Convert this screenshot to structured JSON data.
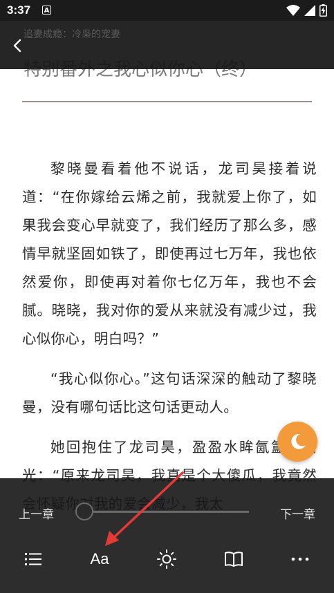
{
  "status_bar": {
    "time": "3:37",
    "notification_letter": "A",
    "icons": [
      "wifi-icon",
      "signal-icon",
      "battery-charging-icon"
    ]
  },
  "top_bar": {
    "book_name": "追妻成瘾：冷枭的宠妻",
    "back_icon": "chevron-left-icon"
  },
  "chapter": {
    "title": "特别番外之我心似你心（终）",
    "paragraphs": [
      "黎晓曼看着他不说话，龙司昊接着说道：“在你嫁给云烯之前，我就爱上你了，如果我会变心早就变了，我们经历了那么多，感情早就坚固如铁了，即使再过七万年，我也依然爱你，即使再对着你七亿万年，我也不会腻。晓晓，我对你的爱从来就没有减少过，我心似你心，明白吗？”",
      "“我心似你心。”这句话深深的触动了黎晓曼，没有哪句话比这句话更动人。",
      "她回抱住了龙司昊，盈盈水眸氤氲着泪光：“原来龙司昊，我真是个大傻瓜，我竟然会怀疑你对我的爱会减少，我太"
    ]
  },
  "controls": {
    "prev_chapter": "上一章",
    "next_chapter": "下一章",
    "progress_fraction": 0.0,
    "font_button_label": "Aa"
  },
  "colors": {
    "night_button": "#f39a3a",
    "annotation_arrow": "#e53935",
    "panel_background": "#161616"
  }
}
